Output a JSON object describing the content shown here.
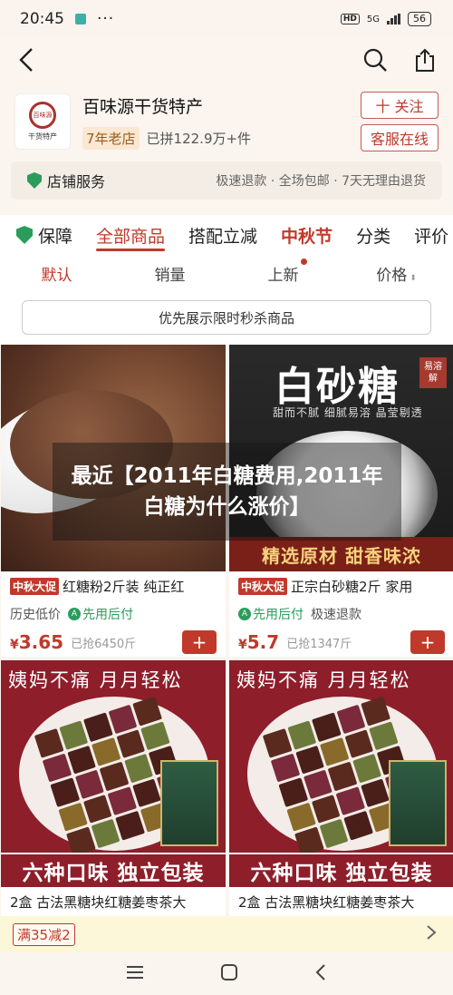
{
  "status": {
    "time": "20:45",
    "network": "5G",
    "hd": "HD",
    "battery": "56"
  },
  "store": {
    "logo_text_top": "百味源",
    "logo_text_bottom": "干货特产",
    "name": "百味源干货特产",
    "age_tag": "7年老店",
    "sales": "已拼122.9万+件",
    "follow_label": "十 关注",
    "service_label": "客服在线"
  },
  "service": {
    "label": "店铺服务",
    "details": "极速退款 · 全场包邮 · 7天无理由退货"
  },
  "tabs": [
    {
      "label": "保障"
    },
    {
      "label": "全部商品"
    },
    {
      "label": "搭配立减"
    },
    {
      "label": "中秋节"
    },
    {
      "label": "分类"
    },
    {
      "label": "评价"
    }
  ],
  "sort": {
    "default": "默认",
    "sales": "销量",
    "new": "上新",
    "price": "价格"
  },
  "promo_toggle": "优先展示限时秒杀商品",
  "overlay_title": "最近【2011年白糖费用,2011年白糖为什么涨价】",
  "products": [
    {
      "tag": "中秋大促",
      "title": "红糖粉2斤装 纯正红",
      "meta1": "历史低价",
      "meta2": "先用后付",
      "price_symbol": "¥",
      "price": "3.65",
      "sold": "已抢6450斤"
    },
    {
      "tag": "中秋大促",
      "title": "正宗白砂糖2斤 家用",
      "meta1": "先用后付",
      "meta2": "极速退款",
      "price_symbol": "¥",
      "price": "5.7",
      "sold": "已抢1347斤",
      "img_title": "白砂糖",
      "img_tag": "易溶解",
      "img_sub": "甜而不腻 细腻易溶 晶莹剔透",
      "img_banner": "精选原材 甜香味浓"
    },
    {
      "title": "2盒 古法黑糖块红糖姜枣茶大",
      "img_headline": "姨妈不痛 月月轻松",
      "img_banner": "六种口味 独立包装"
    },
    {
      "title": "2盒 古法黑糖块红糖姜枣茶大",
      "img_headline": "姨妈不痛 月月轻松",
      "img_banner": "六种口味 独立包装"
    }
  ],
  "coupon": {
    "label": "满35减2"
  },
  "colors": {
    "accent": "#c0392b",
    "green": "#2a9d5c",
    "background": "#fbf5ef"
  },
  "icons": [
    "back-icon",
    "search-icon",
    "share-icon",
    "shield-icon",
    "plus-icon",
    "chevron-right-icon",
    "menu-icon",
    "home-icon"
  ]
}
